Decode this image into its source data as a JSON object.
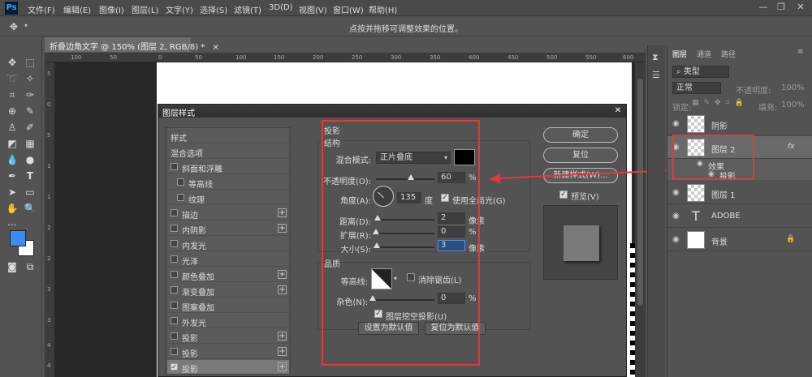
{
  "app": {
    "logo": "Ps",
    "menu": [
      "文件(F)",
      "编辑(E)",
      "图像(I)",
      "图层(L)",
      "文字(Y)",
      "选择(S)",
      "滤镜(T)",
      "3D(D)",
      "视图(V)",
      "窗口(W)",
      "帮助(H)"
    ],
    "window_controls": [
      "—",
      "❐",
      "✕"
    ]
  },
  "options_bar": {
    "hint": "点按并拖移可调整效果的位置。"
  },
  "document": {
    "tab_title": "折叠边角文字 @ 150% (图层 2, RGB/8) *",
    "tab_close": "×",
    "ruler_top_marks": [
      "100",
      "50",
      "0",
      "50",
      "100",
      "150",
      "200",
      "250",
      "300",
      "350",
      "400",
      "450",
      "500",
      "550",
      "600"
    ],
    "ruler_left_marks": [
      "5",
      "0",
      "5",
      "1",
      "1",
      "2",
      "2",
      "3",
      "3",
      "4",
      "4"
    ]
  },
  "dialog": {
    "title": "图层样式",
    "close": "✕",
    "style_list": [
      {
        "label": "样式",
        "checkbox": null,
        "plus": false
      },
      {
        "label": "混合选项",
        "checkbox": null,
        "plus": false
      },
      {
        "label": "斜面和浮雕",
        "checkbox": false,
        "plus": false
      },
      {
        "label": "等高线",
        "checkbox": false,
        "plus": false,
        "indent": true
      },
      {
        "label": "纹理",
        "checkbox": false,
        "plus": false,
        "indent": true
      },
      {
        "label": "描边",
        "checkbox": false,
        "plus": true
      },
      {
        "label": "内阴影",
        "checkbox": false,
        "plus": true
      },
      {
        "label": "内发光",
        "checkbox": false,
        "plus": false
      },
      {
        "label": "光泽",
        "checkbox": false,
        "plus": false
      },
      {
        "label": "颜色叠加",
        "checkbox": false,
        "plus": true
      },
      {
        "label": "渐变叠加",
        "checkbox": false,
        "plus": true
      },
      {
        "label": "图案叠加",
        "checkbox": false,
        "plus": false
      },
      {
        "label": "外发光",
        "checkbox": false,
        "plus": false
      },
      {
        "label": "投影",
        "checkbox": false,
        "plus": true
      },
      {
        "label": "投影",
        "checkbox": false,
        "plus": true
      },
      {
        "label": "投影",
        "checkbox": true,
        "plus": true,
        "selected": true
      }
    ],
    "drop_shadow": {
      "section_title": "投影",
      "structure_title": "结构",
      "blend_mode_label": "混合模式:",
      "blend_mode_value": "正片叠底",
      "blend_color": "#000000",
      "opacity_label": "不透明度(O):",
      "opacity_value": "60",
      "opacity_fraction": 0.6,
      "percent": "%",
      "angle_label": "角度(A):",
      "angle_value": "135",
      "angle_unit": "度",
      "global_light_label": "使用全局光(G)",
      "global_light_checked": true,
      "distance_label": "距离(D):",
      "distance_value": "2",
      "spread_label": "扩展(R):",
      "spread_value": "0",
      "size_label": "大小(S):",
      "size_value": "3",
      "pixel_unit": "像素",
      "quality_title": "品质",
      "contour_label": "等高线:",
      "antialias_label": "消除锯齿(L)",
      "antialias_checked": false,
      "noise_label": "杂色(N):",
      "noise_value": "0",
      "knockout_label": "图层挖空投影(U)",
      "knockout_checked": true,
      "set_default_label": "设置为默认值",
      "reset_default_label": "复位为默认值"
    },
    "buttons": {
      "ok": "确定",
      "reset": "复位",
      "new_style": "新建样式(W)...",
      "preview_label": "预览(V)",
      "preview_checked": true
    }
  },
  "layers_panel": {
    "tabs": [
      "图层",
      "通道",
      "路径"
    ],
    "filter_label": "类型",
    "blend_mode": "正常",
    "opacity_label": "不透明度:",
    "opacity_value": "100%",
    "lock_label": "锁定:",
    "fill_label": "填充:",
    "fill_value": "100%",
    "layers": [
      {
        "name": "阴影",
        "thumb": "checker",
        "visible": true,
        "selected": false
      },
      {
        "name": "图层 2",
        "thumb": "checker",
        "visible": true,
        "selected": true,
        "fx": "fx"
      },
      {
        "name": "图层 1",
        "thumb": "checker",
        "visible": true,
        "selected": false
      },
      {
        "name": "ADOBE",
        "thumb": "text",
        "visible": true,
        "selected": false
      },
      {
        "name": "背景",
        "thumb": "white",
        "visible": true,
        "selected": false,
        "locked": true
      }
    ],
    "effects_label": "效果",
    "effect_item": "投影",
    "text_thumb_glyph": "T"
  },
  "colors": {
    "foreground": "#3c8cf0",
    "background": "#ffffff",
    "highlight": "#e53935"
  }
}
